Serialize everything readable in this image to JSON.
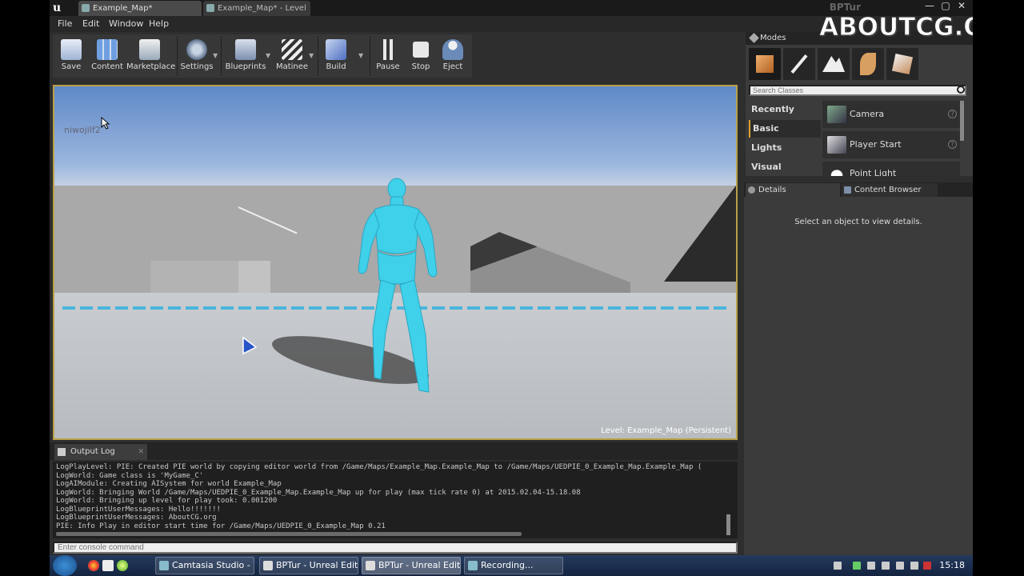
{
  "window": {
    "app_title": "BPTur",
    "tabs": [
      {
        "label": "Example_Map*"
      },
      {
        "label": "Example_Map* - Level Blu"
      }
    ],
    "controls": {
      "minimize": "—",
      "maximize": "▢",
      "close": "✕"
    }
  },
  "menu": {
    "items": [
      "File",
      "Edit",
      "Window",
      "Help"
    ]
  },
  "toolbar": {
    "save": "Save",
    "content": "Content",
    "marketplace": "Marketplace",
    "settings": "Settings",
    "blueprints": "Blueprints",
    "matinee": "Matinee",
    "build": "Build",
    "pause": "Pause",
    "stop": "Stop",
    "eject": "Eject"
  },
  "viewport": {
    "overlay_text": "niwojilf2",
    "level_label": "Level:",
    "level_name": "Example_Map (Persistent)"
  },
  "output_log": {
    "tab_label": "Output Log",
    "lines": [
      "LogPlayLevel: PIE: Created PIE world by copying editor world from /Game/Maps/Example_Map.Example_Map to /Game/Maps/UEDPIE_0_Example_Map.Example_Map (",
      "LogWorld: Game class is 'MyGame_C'",
      "LogAIModule: Creating AISystem for world Example_Map",
      "LogWorld: Bringing World /Game/Maps/UEDPIE_0_Example_Map.Example_Map up for play (max tick rate 0) at 2015.02.04-15.18.08",
      "LogWorld: Bringing up level for play took: 0.001200",
      "LogBlueprintUserMessages: Hello!!!!!!!",
      "LogBlueprintUserMessages: AboutCG.org",
      "PIE: Info Play in editor start time for /Game/Maps/UEDPIE_0_Example_Map 0.21"
    ],
    "console_placeholder": "Enter console command"
  },
  "modes": {
    "tab_label": "Modes",
    "search_placeholder": "Search Classes",
    "categories": [
      "Recently Placed",
      "Basic",
      "Lights",
      "Visual"
    ],
    "items": [
      {
        "label": "Camera"
      },
      {
        "label": "Player Start"
      },
      {
        "label": "Point Light"
      }
    ]
  },
  "details": {
    "tab_details": "Details",
    "tab_content_browser": "Content Browser",
    "empty_message": "Select an object to view details."
  },
  "watermark": "ABOUTCG.ORG",
  "taskbar": {
    "tasks": [
      {
        "label": "Camtasia Studio - ..."
      },
      {
        "label": "BPTur - Unreal Edit..."
      },
      {
        "label": "BPTur - Unreal Edit..."
      },
      {
        "label": "Recording..."
      }
    ],
    "clock": "15:18"
  },
  "colors": {
    "accent_border": "#b8a046",
    "mannequin": "#3fd0ea",
    "selected_category": "#e0a030"
  }
}
